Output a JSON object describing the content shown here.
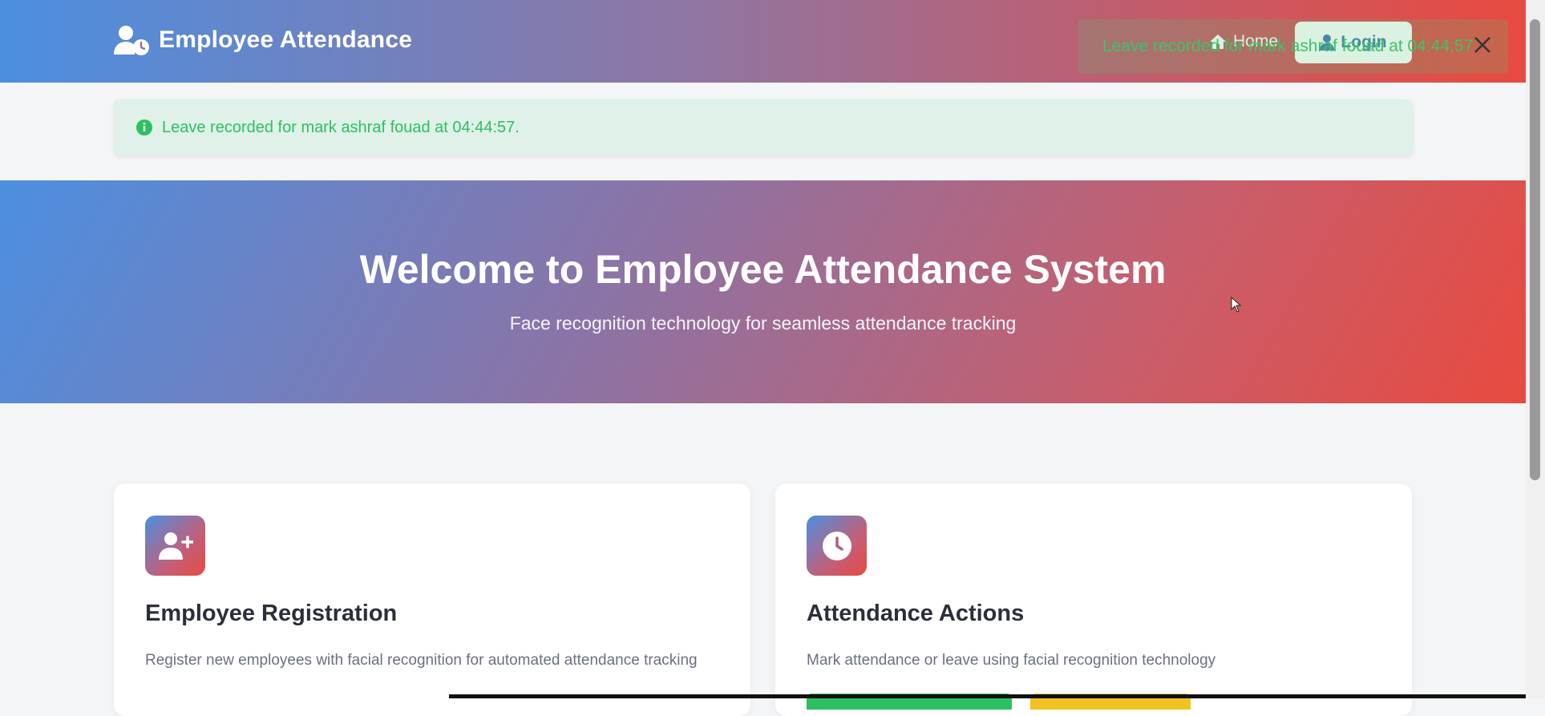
{
  "navbar": {
    "brand": "Employee Attendance",
    "home_label": "Home",
    "login_label": "Login"
  },
  "toast": {
    "message": "Leave recorded for mark ashraf fouad at 04:44:57"
  },
  "alert": {
    "message": "Leave recorded for mark ashraf fouad at 04:44:57."
  },
  "hero": {
    "title": "Welcome to Employee Attendance System",
    "subtitle": "Face recognition technology for seamless attendance tracking"
  },
  "cards": [
    {
      "title": "Employee Registration",
      "description": "Register new employees with facial recognition for automated attendance tracking",
      "icon": "user-plus-icon"
    },
    {
      "title": "Attendance Actions",
      "description": "Mark attendance or leave using facial recognition technology",
      "icon": "clock-icon"
    }
  ],
  "colors": {
    "brand_blue": "#4c8fe0",
    "brand_red": "#e84a3f",
    "success": "#2fbf63",
    "warning": "#f2c320"
  }
}
